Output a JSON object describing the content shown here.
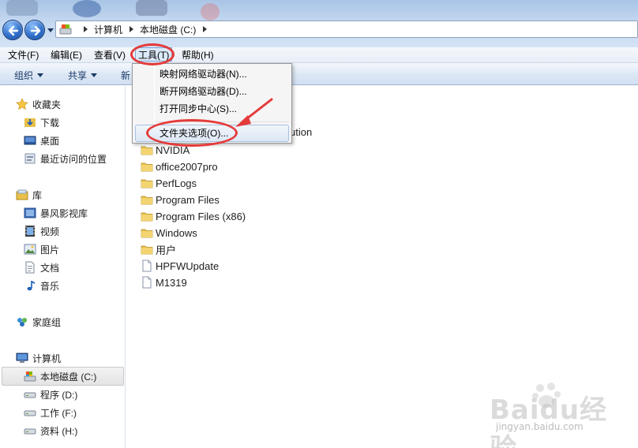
{
  "address_bar": {
    "crumbs": [
      "计算机",
      "本地磁盘 (C:)"
    ]
  },
  "menubar": {
    "items": [
      "文件(F)",
      "编辑(E)",
      "查看(V)",
      "工具(T)",
      "帮助(H)"
    ]
  },
  "command_bar": {
    "organize": "组织",
    "share": "共享",
    "new_folder_partial": "新"
  },
  "nav_pane": {
    "favorites": {
      "label": "收藏夹",
      "items": [
        "下载",
        "桌面",
        "最近访问的位置"
      ]
    },
    "libraries": {
      "label": "库",
      "items": [
        "暴风影视库",
        "视频",
        "图片",
        "文档",
        "音乐"
      ]
    },
    "homegroup": {
      "label": "家庭组"
    },
    "computer": {
      "label": "计算机",
      "items": [
        "本地磁盘 (C:)",
        "程序 (D:)",
        "工作 (F:)",
        "资料 (H:)"
      ]
    }
  },
  "content": {
    "partial_text": "ution",
    "folders": [
      "NVIDIA",
      "office2007pro",
      "PerfLogs",
      "Program Files",
      "Program Files (x86)",
      "Windows",
      "用户"
    ],
    "files": [
      "HPFWUpdate",
      "M1319"
    ]
  },
  "tools_menu": {
    "items": [
      "映射网络驱动器(N)...",
      "断开网络驱动器(D)...",
      "打开同步中心(S)...",
      "文件夹选项(O)..."
    ]
  },
  "watermark": {
    "logo": "Baidu经验",
    "url": "jingyan.baidu.com"
  },
  "colors": {
    "annotation_red": "#e53a3a",
    "folder_yellow": "#e8c04a"
  }
}
